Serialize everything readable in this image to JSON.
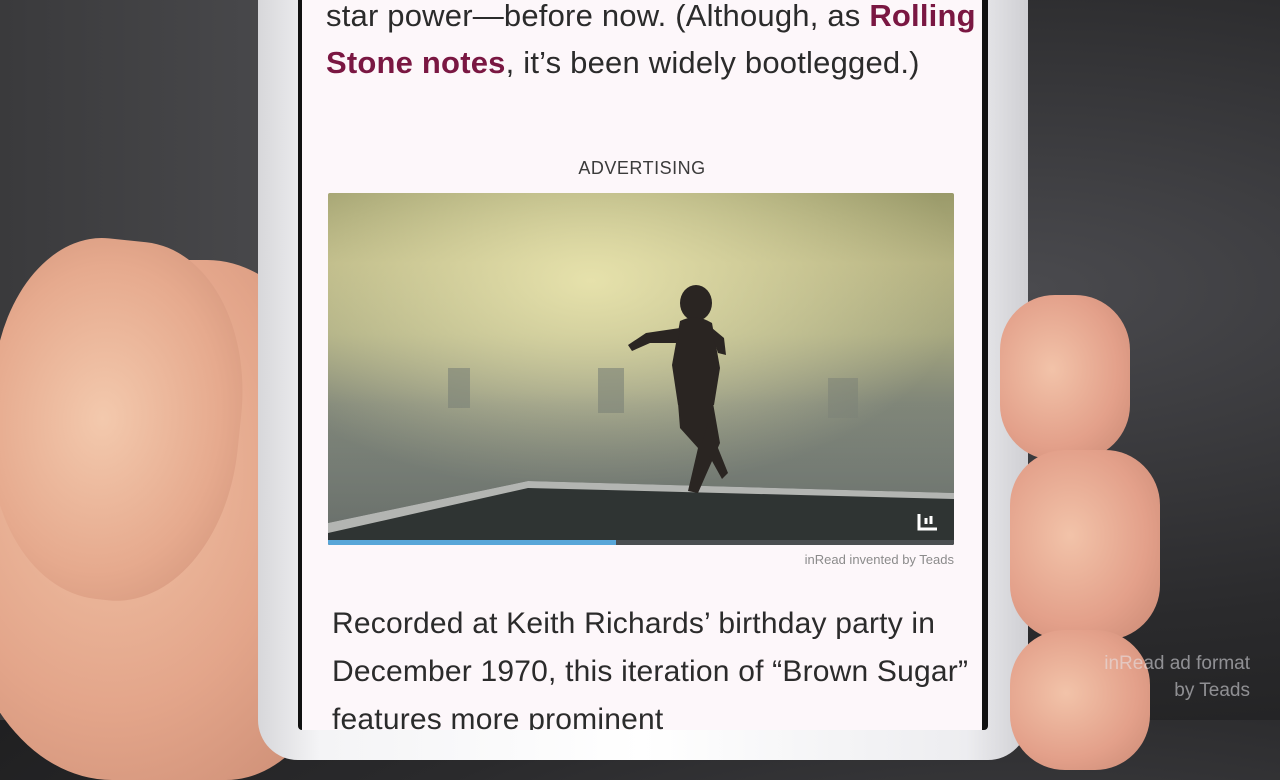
{
  "article": {
    "paragraph_top": {
      "before_link": "star power—before now. (Although, as ",
      "link_text": "Rolling Stone notes",
      "after_link": ", it’s been widely bootlegged.)"
    },
    "ad_label": "ADVERTISING",
    "video": {
      "progress": 0.46,
      "logo_icon": "teads-logo-icon"
    },
    "ad_credit": "inRead invented by Teads",
    "paragraph_bottom": "Recorded at Keith Richards’ birthday party in December 1970, this iteration of “Brown Sugar” features more prominent"
  },
  "watermark": {
    "line1": "inRead ad format",
    "line2": "by Teads"
  },
  "colors": {
    "link": "#7a1742",
    "page_background": "#fdf7fa",
    "progress": "#58a6d8"
  }
}
